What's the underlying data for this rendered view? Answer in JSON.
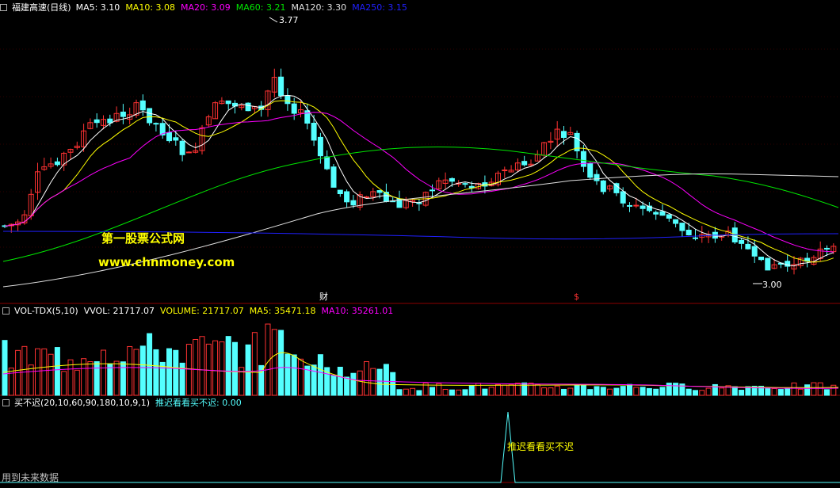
{
  "colors": {
    "background": "#000000",
    "up": "#ff3232",
    "down": "#54ffff",
    "ma5": "#ffffff",
    "ma10": "#ffff00",
    "ma20": "#ff00ff",
    "ma60": "#00e600",
    "ma120": "#e0e0e0",
    "ma250": "#2020ff",
    "grid": "#8b0000",
    "watermark": "#ffff00",
    "indicator": "#54ffff"
  },
  "price_panel": {
    "stock_name": "福建高速(日线)",
    "ma_labels": [
      {
        "text": "MA5: 3.10",
        "color": "#ffffff"
      },
      {
        "text": "MA10: 3.08",
        "color": "#ffff00"
      },
      {
        "text": "MA20: 3.09",
        "color": "#ff00ff"
      },
      {
        "text": "MA60: 3.21",
        "color": "#00e600"
      },
      {
        "text": "MA120: 3.30",
        "color": "#e0e0e0"
      },
      {
        "text": "MA250: 3.15",
        "color": "#2020ff"
      }
    ],
    "high_label": "3.77",
    "low_label": "3.00",
    "event_label_1": "财",
    "event_label_2": "$"
  },
  "watermark": {
    "line1": "第一股票公式网",
    "line2": "www.chnmoney.com"
  },
  "volume_panel": {
    "labels": [
      {
        "text": "VOL-TDX(5,10)",
        "color": "#ffffff"
      },
      {
        "text": "VVOL: 21717.07",
        "color": "#ffffff"
      },
      {
        "text": "VOLUME: 21717.07",
        "color": "#ffff00"
      },
      {
        "text": "MA5: 35471.18",
        "color": "#ffff00"
      },
      {
        "text": "MA10: 35261.01",
        "color": "#ff00ff"
      }
    ]
  },
  "indicator_panel": {
    "labels": [
      {
        "text": "买不迟(20,10,60,90,180,10,9,1)",
        "color": "#ffffff"
      },
      {
        "text": "推迟看看买不迟: 0.00",
        "color": "#54ffff"
      }
    ],
    "signal_label": "推迟看看买不迟",
    "footer_note": "用到未来数据"
  }
}
